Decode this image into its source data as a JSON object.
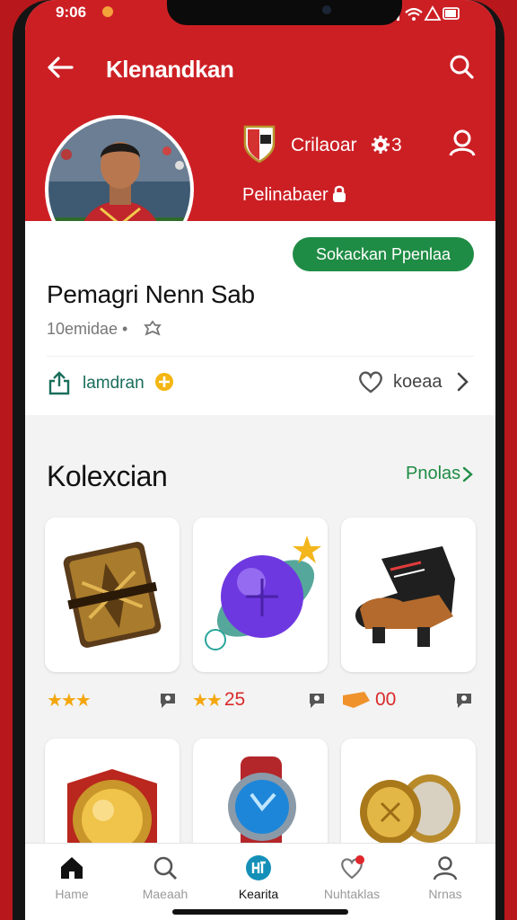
{
  "status": {
    "time": "9:06"
  },
  "appbar": {
    "title": "Klenandkan",
    "back_icon": "arrow-left-icon",
    "search_icon": "search-icon"
  },
  "hero": {
    "club_name": "Crilaoar",
    "club_count": "3",
    "position_label": "Pelinabaer",
    "brand_color": "#cc1f24"
  },
  "profile": {
    "follow_label": "Sokackan Ppenlaa",
    "name": "Pemagri Nenn Sab",
    "meta": "10emidae •",
    "share_label": "lamdran",
    "like_label": "koeaa"
  },
  "collection": {
    "title": "Kolexcian",
    "see_all": "Pnolas",
    "items": [
      {
        "name": "card-pack",
        "stars": "★★★",
        "value": "",
        "icon": "card-pack-icon"
      },
      {
        "name": "orb",
        "stars": "★★",
        "value": "25",
        "icon": "orb-icon"
      },
      {
        "name": "boot",
        "stars": "",
        "value": "00",
        "icon": "boot-icon"
      },
      {
        "name": "medal",
        "icon": "medal-icon"
      },
      {
        "name": "watch",
        "icon": "watch-icon"
      },
      {
        "name": "coins",
        "icon": "coins-icon"
      }
    ]
  },
  "nav": {
    "items": [
      {
        "label": "Hame",
        "icon": "home-icon"
      },
      {
        "label": "Maeaah",
        "icon": "search-icon"
      },
      {
        "label": "Kearita",
        "icon": "collection-icon"
      },
      {
        "label": "Nuhtaklas",
        "icon": "heart-icon"
      },
      {
        "label": "Nrnas",
        "icon": "profile-icon"
      }
    ],
    "active_index": 2
  },
  "colors": {
    "accent_green": "#1f8c45",
    "accent_red": "#cc1f24",
    "star": "#f4a60c"
  }
}
